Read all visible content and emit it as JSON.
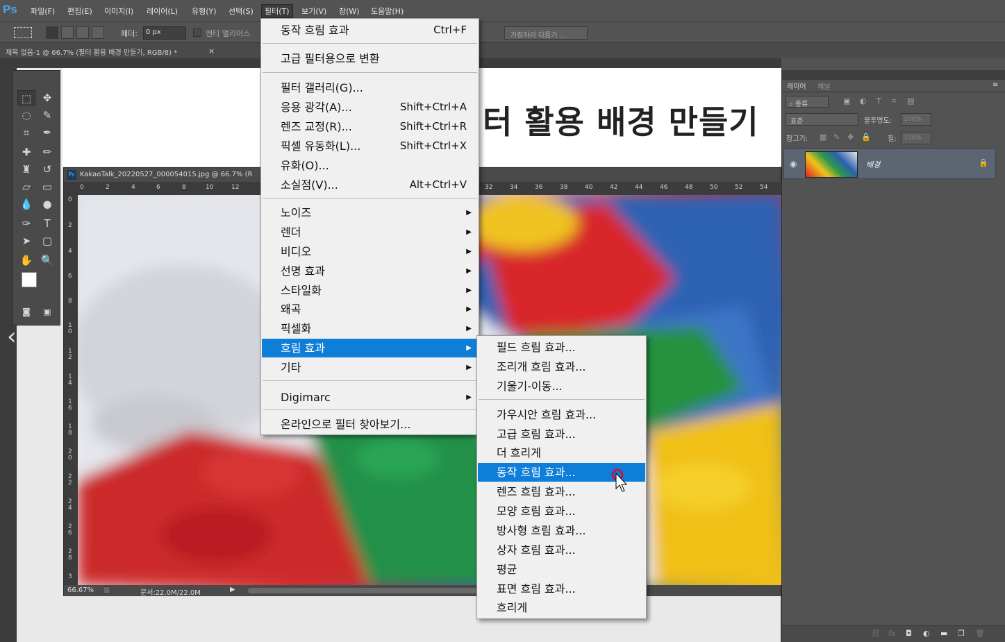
{
  "app": {
    "logo": "Ps"
  },
  "menubar": {
    "items": [
      "파일(F)",
      "편집(E)",
      "이미지(I)",
      "레이어(L)",
      "유형(Y)",
      "선택(S)",
      "필터(T)",
      "보기(V)",
      "창(W)",
      "도움말(H)"
    ]
  },
  "options": {
    "feather_label": "페더:",
    "feather_value": "0 px",
    "antialias_label": "앤티 앨리어스",
    "refine_edge": "가장자리 다듬기 ..."
  },
  "document_tab": {
    "title": "제목 없음-1 @ 66.7% (필터 활용 배경 만들기, RGB/8) *",
    "close": "×"
  },
  "document": {
    "heading": "터 활용 배경 만들기"
  },
  "image_window": {
    "title": "KakaoTalk_20220527_000054015.jpg @ 66.7% (R",
    "zoom": "66.67%",
    "doc_size": "문서:22.0M/22.0M",
    "ruler_top": [
      "0",
      "2",
      "4",
      "6",
      "8",
      "10",
      "12",
      "32",
      "34",
      "36",
      "38",
      "40",
      "42",
      "44",
      "46",
      "48",
      "50",
      "52",
      "54"
    ],
    "ruler_left": [
      "0",
      "2",
      "4",
      "6",
      "8",
      "1\n0",
      "1\n2",
      "1\n4",
      "1\n6",
      "1\n8",
      "2\n0",
      "2\n2",
      "2\n4",
      "2\n6",
      "2\n8",
      "3"
    ]
  },
  "layers_panel": {
    "tabs": [
      "레이어",
      "채널"
    ],
    "filter_kind": "종류",
    "blend_mode": "표준",
    "opacity_label": "불투명도:",
    "opacity_value": "100%",
    "lock_label": "잠그기:",
    "fill_label": "칠:",
    "fill_value": "100%",
    "layer_name": "배경"
  },
  "filter_menu": {
    "items": [
      {
        "label": "동작 흐림 효과",
        "shortcut": "Ctrl+F"
      },
      {
        "label": "고급 필터용으로 변환"
      },
      {
        "label": "필터 갤러리(G)..."
      },
      {
        "label": "응용 광각(A)...",
        "shortcut": "Shift+Ctrl+A"
      },
      {
        "label": "렌즈 교정(R)...",
        "shortcut": "Shift+Ctrl+R"
      },
      {
        "label": "픽셀 유동화(L)...",
        "shortcut": "Shift+Ctrl+X"
      },
      {
        "label": "유화(O)..."
      },
      {
        "label": "소실점(V)...",
        "shortcut": "Alt+Ctrl+V"
      },
      {
        "label": "노이즈"
      },
      {
        "label": "렌더"
      },
      {
        "label": "비디오"
      },
      {
        "label": "선명 효과"
      },
      {
        "label": "스타일화"
      },
      {
        "label": "왜곡"
      },
      {
        "label": "픽셀화"
      },
      {
        "label": "흐림 효과"
      },
      {
        "label": "기타"
      },
      {
        "label": "Digimarc"
      },
      {
        "label": "온라인으로 필터 찾아보기..."
      }
    ]
  },
  "blur_submenu": {
    "items": [
      "필드 흐림 효과...",
      "조리개 흐림 효과...",
      "기울기-이동...",
      "가우시안 흐림 효과...",
      "고급 흐림 효과...",
      "더 흐리게",
      "동작 흐림 효과...",
      "렌즈 흐림 효과...",
      "모양 흐림 효과...",
      "방사형 흐림 효과...",
      "상자 흐림 효과...",
      "평균",
      "표면 흐림 효과...",
      "흐리게"
    ]
  },
  "colors": {
    "highlight": "#0f7ed8",
    "menu_bg": "#f0f0f0",
    "ui_dark": "#535353"
  }
}
